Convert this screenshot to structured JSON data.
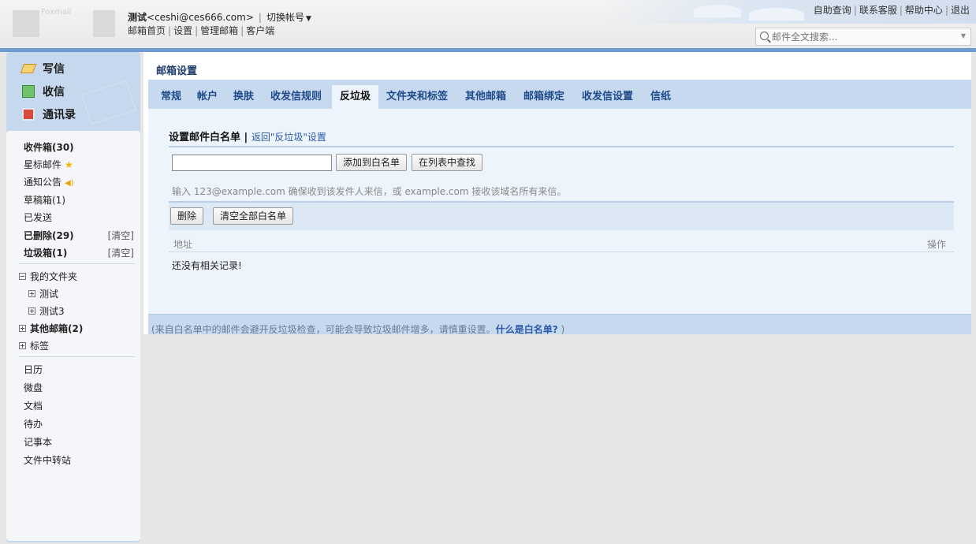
{
  "header": {
    "logo_text": "Foxmail",
    "user_name": "测试",
    "user_email": "<ceshi@ces666.com>",
    "separator": "|",
    "switch_account": "切换帐号",
    "nav": [
      "邮箱首页",
      "设置",
      "管理邮箱",
      "客户端"
    ],
    "top_links": [
      "自助查询",
      "联系客服",
      "帮助中心",
      "退出"
    ],
    "search_placeholder": "邮件全文搜索..."
  },
  "sidebar": {
    "actions": [
      {
        "label": "写信",
        "icon": "compose-icon"
      },
      {
        "label": "收信",
        "icon": "receive-icon"
      },
      {
        "label": "通讯录",
        "icon": "contacts-icon"
      }
    ],
    "folders": [
      {
        "label": "收件箱(30)",
        "bold": true
      },
      {
        "label": "星标邮件",
        "icon": "star-icon"
      },
      {
        "label": "通知公告",
        "icon": "speaker-icon"
      },
      {
        "label": "草稿箱(1)"
      },
      {
        "label": "已发送"
      },
      {
        "label": "已删除(29)",
        "bold": true,
        "action": "[清空]"
      },
      {
        "label": "垃圾箱(1)",
        "bold": true,
        "action": "[清空]"
      }
    ],
    "my_folders": {
      "label": "我的文件夹",
      "children": [
        "测试",
        "测试3"
      ]
    },
    "other_mailbox": "其他邮箱(2)",
    "tags": "标签",
    "apps": [
      "日历",
      "微盘",
      "文档",
      "待办",
      "记事本",
      "文件中转站"
    ]
  },
  "main": {
    "title": "邮箱设置",
    "tabs": [
      "常规",
      "帐户",
      "换肤",
      "收发信规则",
      "反垃圾",
      "文件夹和标签",
      "其他邮箱",
      "邮箱绑定",
      "收发信设置",
      "信纸"
    ],
    "active_tab": "反垃圾",
    "section_title": "设置邮件白名单",
    "section_sep": "|",
    "back_link": "返回\"反垃圾\"设置",
    "input_value": "",
    "add_button": "添加到白名单",
    "find_button": "在列表中查找",
    "hint": "输入 123@example.com 确保收到该发件人来信，或 example.com 接收该域名所有来信。",
    "delete_button": "删除",
    "clear_all_button": "清空全部白名单",
    "col_address": "地址",
    "col_action": "操作",
    "empty_text": "还没有相关记录!",
    "footer_note": "(来自白名单中的邮件会避开反垃圾检查，可能会导致垃圾邮件增多，请慎重设置。",
    "footer_link": "什么是白名单?",
    "footer_close": " )"
  },
  "colors": {
    "accent": "#6f9bd0",
    "tab_bar": "#c6d9ef",
    "sidebar": "#c6d8ee",
    "link": "#2a5aa8"
  }
}
